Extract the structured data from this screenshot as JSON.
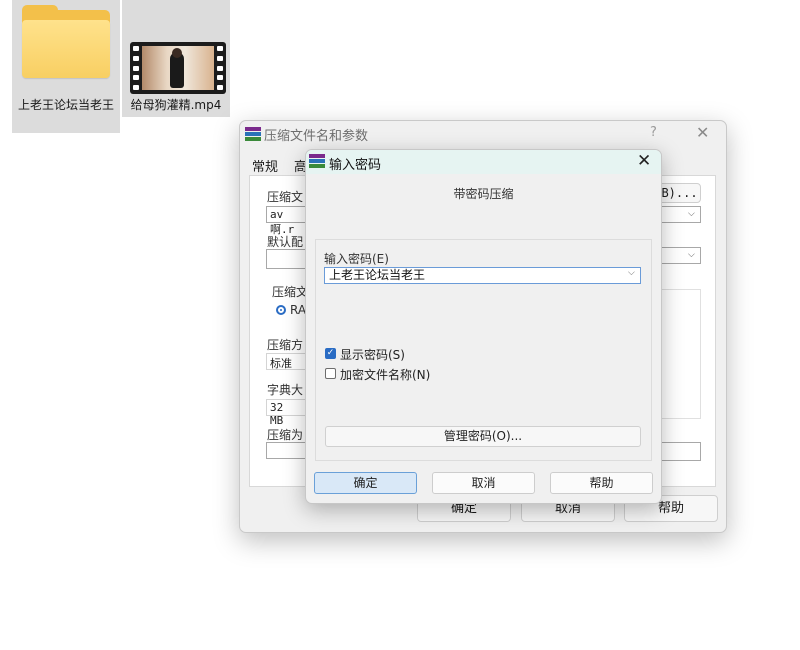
{
  "desktop": {
    "items": [
      {
        "label": "上老王论坛当老王",
        "icon": "folder-icon"
      },
      {
        "label": "给母狗灌精.mp4",
        "icon": "video-file-icon"
      }
    ]
  },
  "archive_window": {
    "title": "压缩文件名和参数",
    "help_glyph": "?",
    "close_glyph": "✕",
    "tabs": [
      "常规",
      "高"
    ],
    "field_labels": {
      "archive_name": "压缩文",
      "default_profile": "默认配",
      "format": "压缩文",
      "method": "压缩方",
      "dictionary": "字典大",
      "split": "压缩为"
    },
    "values": {
      "archive_name": "av啊.r",
      "format_option": "RA",
      "method": "标准",
      "dictionary": "32 MB",
      "browse_button": "B)..."
    },
    "buttons": {
      "ok": "确定",
      "cancel": "取消",
      "help": "帮助"
    }
  },
  "password_dialog": {
    "title": "输入密码",
    "close_glyph": "✕",
    "heading": "带密码压缩",
    "password_label": "输入密码(E)",
    "password_value": "上老王论坛当老王",
    "show_password": {
      "label": "显示密码(S)",
      "checked": true
    },
    "encrypt_names": {
      "label": "加密文件名称(N)",
      "checked": false
    },
    "manage_button": "管理密码(O)...",
    "buttons": {
      "ok": "确定",
      "cancel": "取消",
      "help": "帮助"
    }
  },
  "colors": {
    "accent": "#2a6cc4",
    "dialog_titlebar": "#e6f4f2",
    "primary_button": "#d9e8f7",
    "folder": "#f8cf62"
  }
}
